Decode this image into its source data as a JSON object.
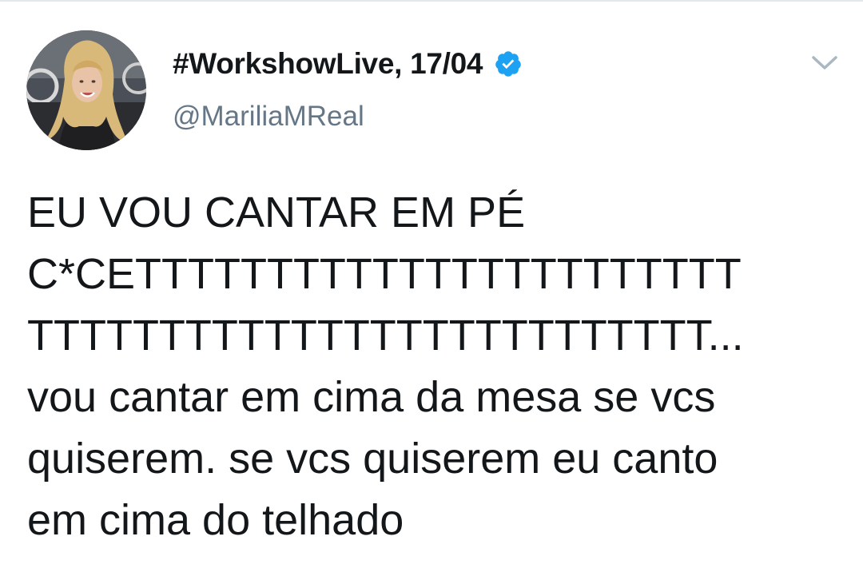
{
  "tweet": {
    "display_name": "#WorkshowLive, 17/04",
    "handle": "@MariliaMReal",
    "verified": true,
    "text_lines": [
      "EU VOU CANTAR EM PÉ",
      "C*CETTTTTTTTTTTTTTTTTTTTTTT",
      "TTTTTTTTTTTTTTTTTTTTTTTTTT...",
      "vou cantar em cima da mesa se vcs",
      "quiserem. se vcs quiserem eu canto",
      "em cima do telhado"
    ]
  },
  "icons": {
    "verified": "verified-badge-icon",
    "menu": "chevron-down-icon",
    "avatar": "profile-photo"
  },
  "colors": {
    "text": "#14171a",
    "secondary_text": "#657786",
    "verified_badge": "#1da1f2",
    "chevron": "#aab8c2",
    "divider": "#e1e8ed"
  }
}
